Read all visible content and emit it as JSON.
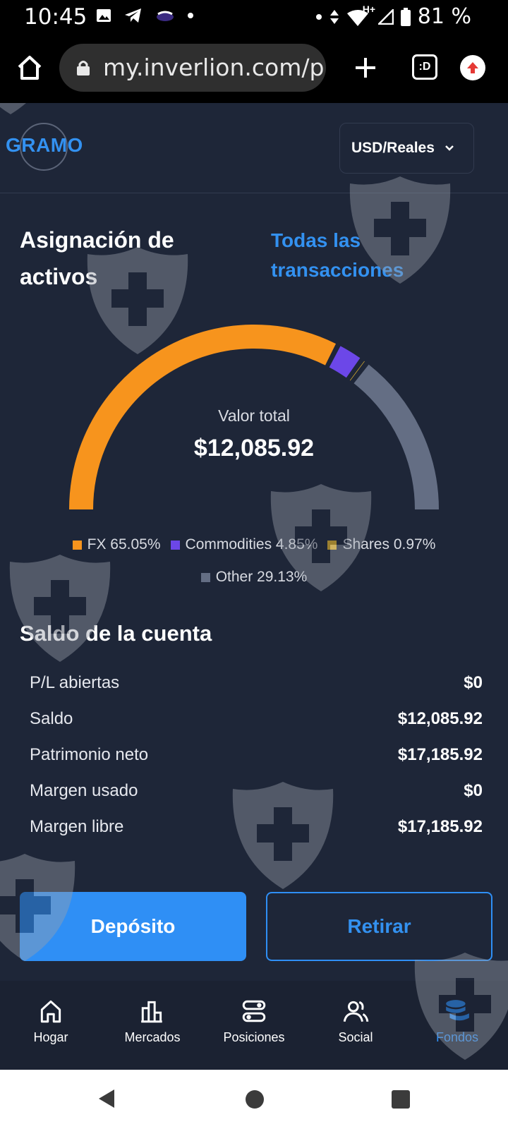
{
  "status_bar": {
    "time": "10:45",
    "battery": "81 %",
    "network": "H+"
  },
  "browser": {
    "url": "my.inverlion.com/p",
    "tabs_icon_text": ":D"
  },
  "header": {
    "brand": "GRAMO",
    "currency": "USD/Reales"
  },
  "allocation": {
    "title": "Asignación de activos",
    "link": "Todas las transacciones",
    "total_label": "Valor total",
    "total_value": "$12,085.92",
    "legend": [
      {
        "label": "FX 65.05%",
        "name": "FX",
        "percent": 65.05,
        "color": "#f7941d"
      },
      {
        "label": "Commodities 4.85%",
        "name": "Commodities",
        "percent": 4.85,
        "color": "#6c47e8"
      },
      {
        "label": "Shares 0.97%",
        "name": "Shares",
        "percent": 0.97,
        "color": "#f7c22b"
      },
      {
        "label": "Other 29.13%",
        "name": "Other",
        "percent": 29.13,
        "color": "#646e84"
      }
    ]
  },
  "balance": {
    "title": "Saldo de la cuenta",
    "rows": [
      {
        "label": "P/L abiertas",
        "value": "$0"
      },
      {
        "label": "Saldo",
        "value": "$12,085.92"
      },
      {
        "label": "Patrimonio neto",
        "value": "$17,185.92"
      },
      {
        "label": "Margen usado",
        "value": "$0"
      },
      {
        "label": "Margen libre",
        "value": "$17,185.92"
      }
    ]
  },
  "actions": {
    "deposit": "Depósito",
    "withdraw": "Retirar"
  },
  "nav": {
    "items": [
      {
        "label": "Hogar",
        "icon": "home-icon"
      },
      {
        "label": "Mercados",
        "icon": "markets-icon"
      },
      {
        "label": "Posiciones",
        "icon": "positions-icon"
      },
      {
        "label": "Social",
        "icon": "social-icon"
      },
      {
        "label": "Fondos",
        "icon": "funds-icon",
        "active": true
      }
    ]
  },
  "colors": {
    "accent": "#2f8ff5",
    "background": "#1e2638"
  }
}
